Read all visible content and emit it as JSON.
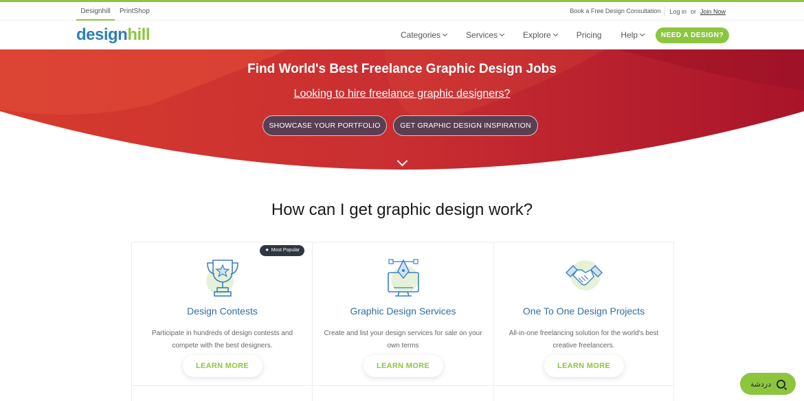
{
  "utility_bar": {
    "tabs": [
      "Designhill",
      "PrintShop"
    ],
    "consultation": "Book a Free Design Consultation",
    "login": "Log in",
    "or": "or",
    "join": "Join Now"
  },
  "nav": {
    "logo_part1": "design",
    "logo_part2": "hill",
    "items": [
      "Categories",
      "Services",
      "Explore",
      "Pricing",
      "Help"
    ],
    "cta": "NEED A DESIGN?"
  },
  "hero": {
    "title": "Find World's Best Freelance Graphic Design Jobs",
    "link": "Looking to hire freelance graphic designers?",
    "button1": "SHOWCASE YOUR PORTFOLIO",
    "button2": "GET GRAPHIC DESIGN INSPIRATION"
  },
  "section": {
    "title": "How can I get graphic design work?"
  },
  "cards": [
    {
      "title": "Design Contests",
      "desc": "Participate in hundreds of design contests and compete with the best designers.",
      "button": "LEARN MORE",
      "badge": "Most Popular",
      "icon": "trophy-icon"
    },
    {
      "title": "Graphic Design Services",
      "desc": "Create and list your design services for sale on your own terms",
      "button": "LEARN MORE",
      "icon": "design-monitor-icon"
    },
    {
      "title": "One To One Design Projects",
      "desc": "All-in-one freelancing solution for the world's best creative freelancers.",
      "button": "LEARN MORE",
      "icon": "handshake-icon"
    }
  ],
  "chat": {
    "label": "دردشة"
  },
  "colors": {
    "accent": "#8cc63f",
    "brand_blue": "#2d7fb8",
    "hero_red": "#c52a30"
  }
}
